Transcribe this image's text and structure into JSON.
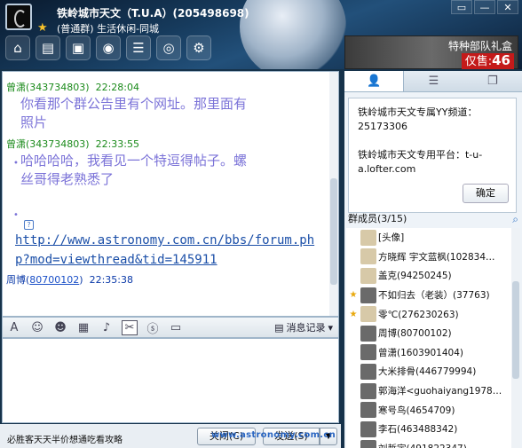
{
  "title": {
    "group_name": "铁岭城市天文（T.U.A）(205498698)",
    "group_sub": "(普通群) 生活休闲-同城"
  },
  "window_controls": [
    "▭",
    "—",
    "✕"
  ],
  "toolbar": {
    "icons": [
      "home-icon",
      "folder-icon",
      "album-icon",
      "voice-icon",
      "apps-icon",
      "video-icon",
      "settings-icon"
    ]
  },
  "ad": {
    "title": "特种部队礼盒",
    "price_label": "仅售:",
    "price_value": "46"
  },
  "messages": [
    {
      "sender": "曾潇(343734803)",
      "time": "22:28:04",
      "lines": [
        "你看那个群公告里有个网址。那里面有",
        "照片"
      ]
    },
    {
      "sender": "曾潇(343734803)",
      "time": "22:33:55",
      "lines": [
        "哈哈哈哈，我看见一个特逗得帖子。螺",
        "丝哥得老熟悉了"
      ]
    },
    {
      "link": "http://www.astronomy.com.cn/bbs/forum.php?mod=viewthread&tid=145911"
    },
    {
      "sender_name": "周博",
      "sender_id": "80700102",
      "time": "22:35:38"
    }
  ],
  "input_toolbar": {
    "icons": [
      "font-icon",
      "emoji-icon",
      "face-icon",
      "mosaic-icon",
      "bell-icon",
      "scissors-icon",
      "screenshot-icon",
      "more-icon"
    ],
    "history_label": "消息记录"
  },
  "bottom": {
    "tip": "必胜客天天半价想通吃看攻略",
    "close_label": "关闭(C)",
    "send_label": "发送(S)",
    "watermark": "www.astronomy.com.cn"
  },
  "right_tabs": [
    "person-icon",
    "list-icon",
    "files-icon"
  ],
  "notice": {
    "yy_label": "铁岭城市天文专属YY频道：",
    "yy_value": "25173306",
    "platform_label": "铁岭城市天文专用平台：t-u-a.lofter.com",
    "ok_label": "确定"
  },
  "members": {
    "header": "群成员(3/15)",
    "list": [
      {
        "role": "",
        "name": "[头像] ",
        "avatar": "g"
      },
      {
        "role": "",
        "name": "方晓辉  宇文蓝枫(102834…",
        "avatar": "g"
      },
      {
        "role": "",
        "name": "盖克(94250245)",
        "avatar": "g"
      },
      {
        "role": "★",
        "name": "不如归去（老装）(37763)",
        "avatar": "w"
      },
      {
        "role": "★",
        "name": "零℃(276230263)",
        "avatar": "g"
      },
      {
        "role": "",
        "name": "周博(80700102)",
        "avatar": "w"
      },
      {
        "role": "",
        "name": "曾潇(1603901404)",
        "avatar": "w"
      },
      {
        "role": "",
        "name": "大米排骨(446779994)",
        "avatar": "w"
      },
      {
        "role": "",
        "name": "郭海洋<guohaiyang1978…",
        "avatar": "w"
      },
      {
        "role": "",
        "name": "寒号鸟(4654709)",
        "avatar": "w"
      },
      {
        "role": "",
        "name": "李石(463488342)",
        "avatar": "w"
      },
      {
        "role": "",
        "name": "刘哲宇(491822347)",
        "avatar": "w"
      }
    ]
  },
  "colors": {
    "title_bg": "#163a5c",
    "message_text": "#7b73d8",
    "sender_green": "#1a8a1a",
    "link_blue": "#1b4fa8",
    "ad_red": "#c41a1a"
  }
}
